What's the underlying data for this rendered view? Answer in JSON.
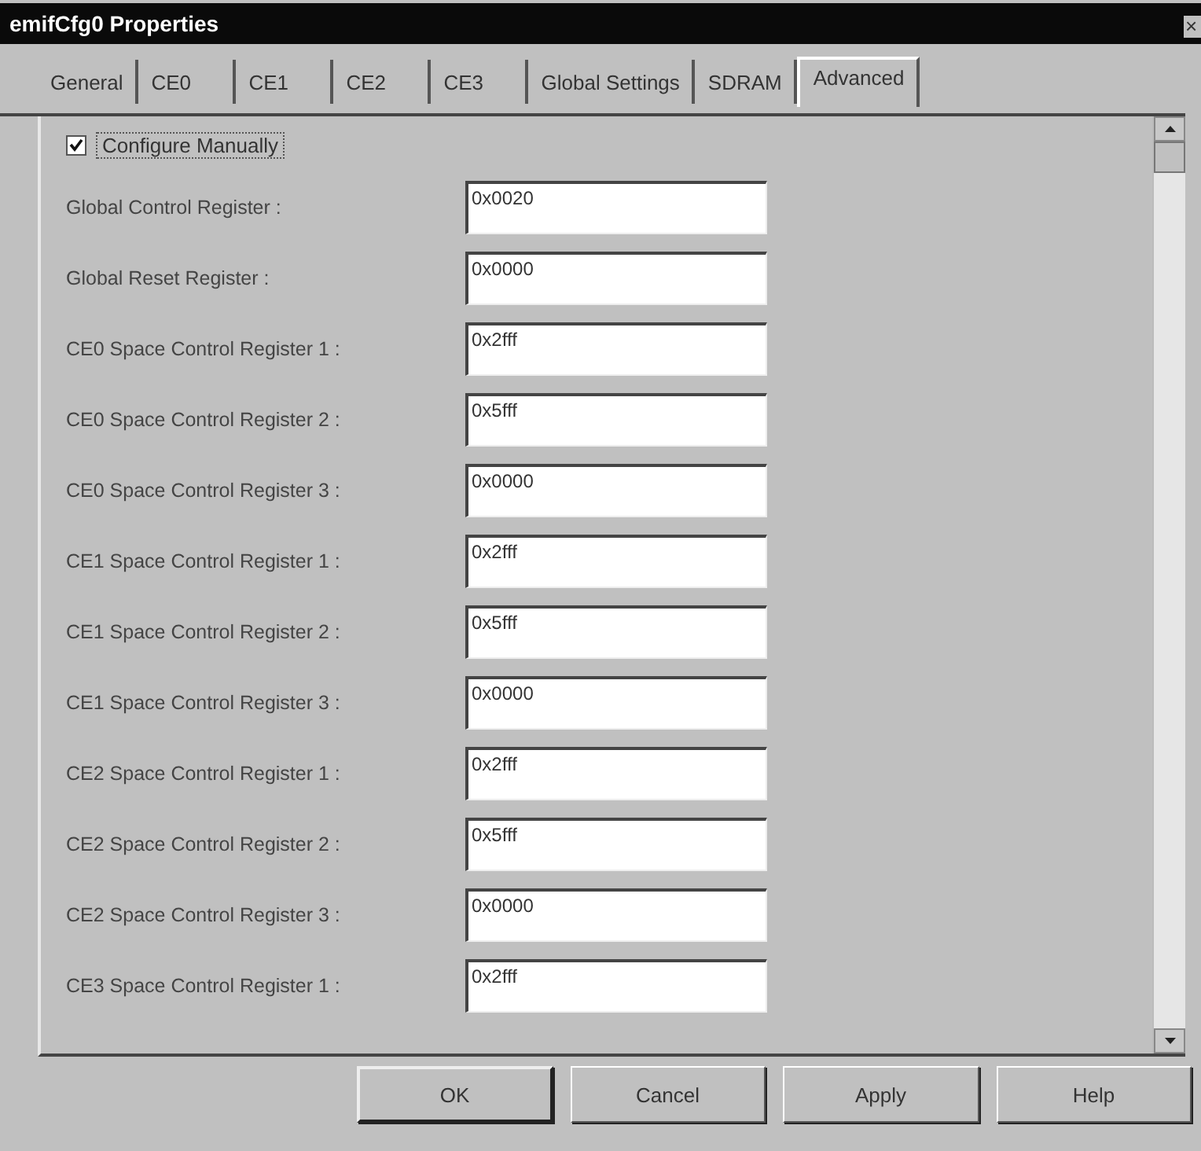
{
  "window": {
    "title": "emifCfg0 Properties",
    "close": "×"
  },
  "tabs": [
    {
      "label": "General",
      "selected": false
    },
    {
      "label": "CE0",
      "selected": false
    },
    {
      "label": "CE1",
      "selected": false
    },
    {
      "label": "CE2",
      "selected": false
    },
    {
      "label": "CE3",
      "selected": false
    },
    {
      "label": "Global Settings",
      "selected": false
    },
    {
      "label": "SDRAM",
      "selected": false
    },
    {
      "label": "Advanced",
      "selected": true
    }
  ],
  "configure_manually": {
    "label": "Configure Manually",
    "checked": true
  },
  "registers": [
    {
      "label": "Global Control Register :",
      "value": "0x0020"
    },
    {
      "label": "Global Reset Register :",
      "value": "0x0000"
    },
    {
      "label": "CE0 Space Control Register 1 :",
      "value": "0x2fff"
    },
    {
      "label": "CE0 Space Control Register 2 :",
      "value": "0x5fff"
    },
    {
      "label": "CE0 Space Control Register 3 :",
      "value": "0x0000"
    },
    {
      "label": "CE1 Space Control Register 1 :",
      "value": "0x2fff"
    },
    {
      "label": "CE1 Space Control Register 2 :",
      "value": "0x5fff"
    },
    {
      "label": "CE1 Space Control Register 3 :",
      "value": "0x0000"
    },
    {
      "label": "CE2 Space Control Register 1 :",
      "value": "0x2fff"
    },
    {
      "label": "CE2 Space Control Register 2 :",
      "value": "0x5fff"
    },
    {
      "label": "CE2 Space Control Register 3 :",
      "value": "0x0000"
    },
    {
      "label": "CE3 Space Control Register 1 :",
      "value": "0x2fff"
    }
  ],
  "buttons": [
    {
      "label": "OK",
      "default": true
    },
    {
      "label": "Cancel",
      "default": false
    },
    {
      "label": "Apply",
      "default": false
    },
    {
      "label": "Help",
      "default": false
    }
  ]
}
